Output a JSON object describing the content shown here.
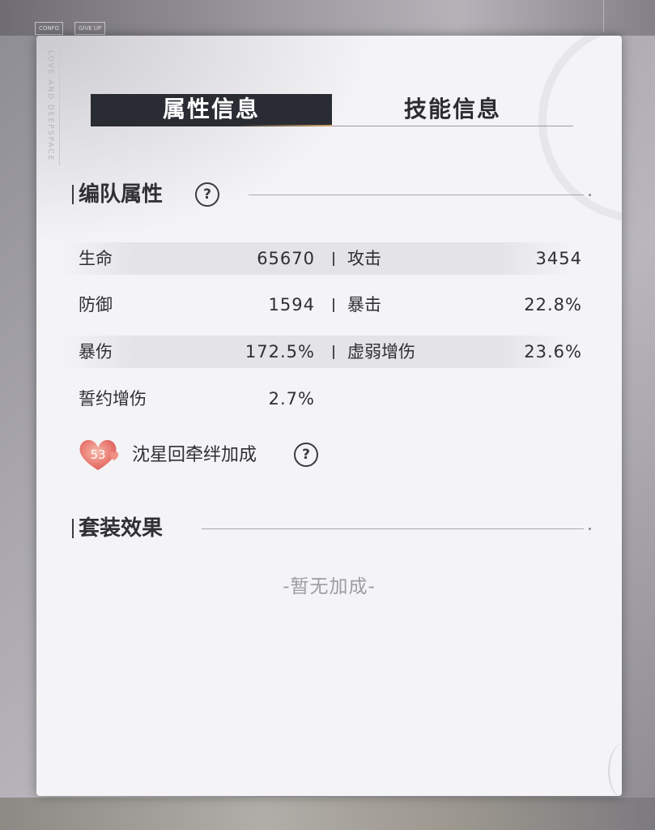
{
  "background": {
    "small_buttons": [
      "CONFG",
      "GIVE UP"
    ]
  },
  "panel": {
    "side_text": "LOVE AND DEEPSPACE",
    "tabs": [
      {
        "label": "属性信息",
        "active": true
      },
      {
        "label": "技能信息",
        "active": false
      }
    ]
  },
  "team_attributes": {
    "title": "编队属性",
    "help_symbol": "?",
    "stats": [
      {
        "left_label": "生命",
        "left_value": "65670",
        "right_label": "攻击",
        "right_value": "3454"
      },
      {
        "left_label": "防御",
        "left_value": "1594",
        "right_label": "暴击",
        "right_value": "22.8%"
      },
      {
        "left_label": "暴伤",
        "left_value": "172.5%",
        "right_label": "虚弱增伤",
        "right_value": "23.6%"
      },
      {
        "left_label": "誓约增伤",
        "left_value": "2.7%"
      }
    ]
  },
  "bond": {
    "level": "53",
    "text": "沈星回牵绊加成",
    "help_symbol": "?"
  },
  "set_effect": {
    "title": "套装效果",
    "empty_text": "-暂无加成-"
  },
  "colors": {
    "active_tab_bg": "#2a2c33",
    "heart": "#e8736a",
    "accent_gold": "#d4a56a"
  }
}
